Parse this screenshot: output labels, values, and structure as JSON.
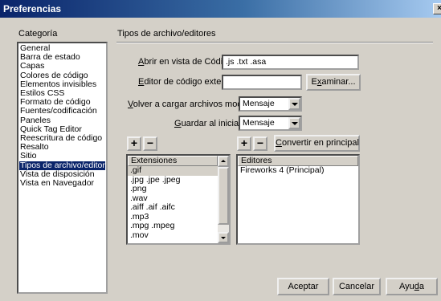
{
  "window": {
    "title": "Preferencias",
    "close_glyph": "×"
  },
  "sidebar": {
    "heading": "Categoría",
    "items": [
      {
        "label": "General"
      },
      {
        "label": "Barra de estado"
      },
      {
        "label": "Capas"
      },
      {
        "label": "Colores de código"
      },
      {
        "label": "Elementos invisibles"
      },
      {
        "label": "Estilos CSS"
      },
      {
        "label": "Formato de código"
      },
      {
        "label": "Fuentes/codificación"
      },
      {
        "label": "Paneles"
      },
      {
        "label": "Quick Tag Editor"
      },
      {
        "label": "Reescritura de código"
      },
      {
        "label": "Resalto"
      },
      {
        "label": "Sitio"
      },
      {
        "label": "Tipos de archivo/editores",
        "selected": true
      },
      {
        "label": "Vista de disposición"
      },
      {
        "label": "Vista en Navegador"
      }
    ]
  },
  "panel": {
    "heading": "Tipos de archivo/editores",
    "open_in_code": {
      "label": "Abrir en vista de Código:",
      "value": ".js .txt .asa"
    },
    "external_editor": {
      "label": "Editor de código externo:",
      "value": "",
      "browse_label": "Examinar..."
    },
    "reload": {
      "label": "Volver a cargar archivos modif.:",
      "value": "Mensaje"
    },
    "save_on_start": {
      "label": "Guardar al iniciar:",
      "value": "Mensaje"
    },
    "plus_glyph": "+",
    "minus_glyph": "−",
    "make_primary_label": "Convertir en principal",
    "extensions": {
      "header": "Extensiones",
      "items": [
        ".gif",
        ".jpg .jpe .jpeg",
        ".png",
        ".wav",
        ".aiff .aif .aifc",
        ".mp3",
        ".mpg .mpeg",
        ".mov"
      ],
      "selected_index": 0
    },
    "editors": {
      "header": "Editores",
      "items": [
        "Fireworks 4 (Principal)"
      ]
    }
  },
  "footer": {
    "ok_label": "Aceptar",
    "cancel_label": "Cancelar",
    "help_label": "Ayuda"
  }
}
